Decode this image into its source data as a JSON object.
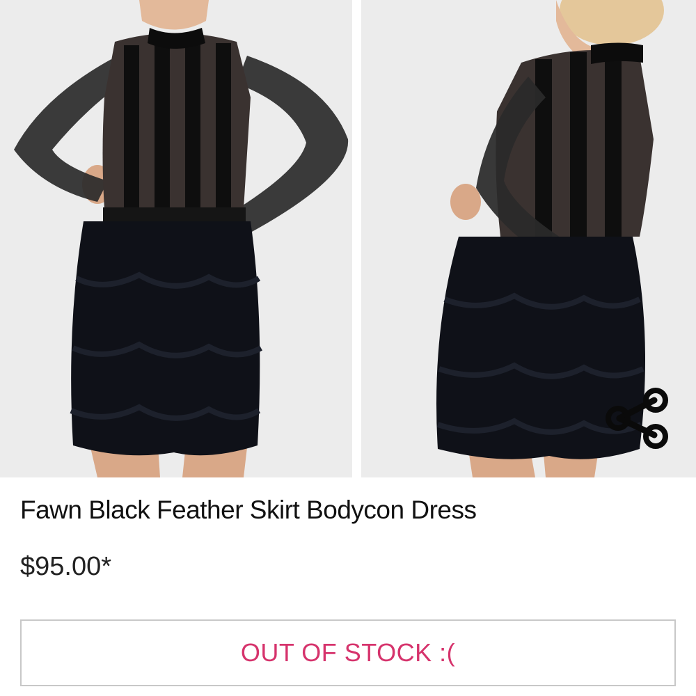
{
  "gallery": {
    "images": [
      {
        "name": "product-photo-front"
      },
      {
        "name": "product-photo-back"
      }
    ],
    "share_icon": "share-icon"
  },
  "product": {
    "title": "Fawn Black Feather Skirt Bodycon Dress",
    "price": "$95.00*"
  },
  "stock_button": {
    "label": "OUT OF STOCK :(",
    "label_color": "#d6336c",
    "border_color": "#c8c8c8"
  }
}
